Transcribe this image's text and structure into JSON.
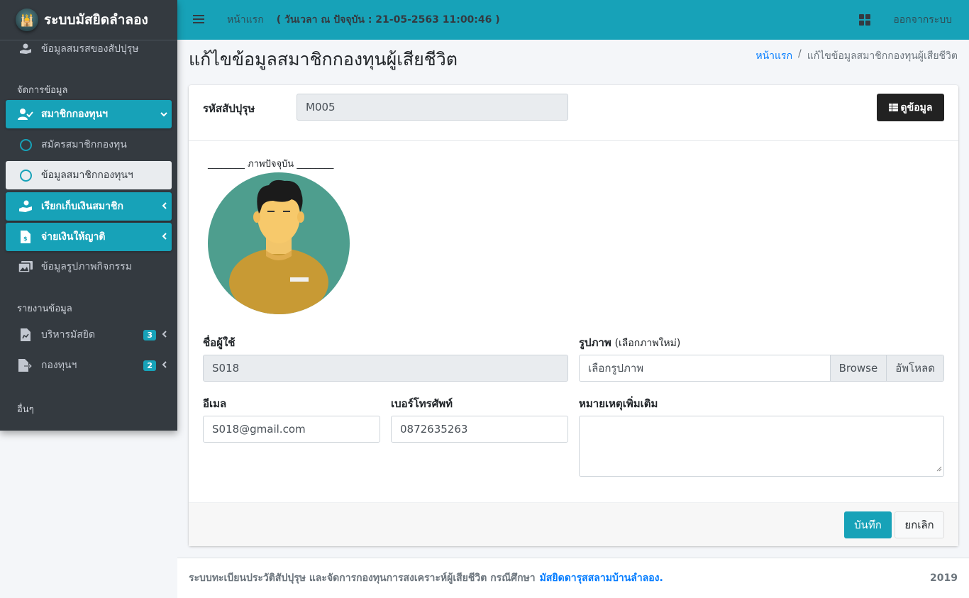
{
  "app": {
    "brand": "ระบบมัสยิดลำลอง"
  },
  "sidebar": {
    "top_item": "ข้อมูลสมรสของสัปปุรุษ",
    "header_manage": "จัดการข้อมูล",
    "members": "สมาชิกกองทุนฯ",
    "register": "สมัครสมาชิกกองทุน",
    "member_data": "ข้อมูลสมาชิกกองทุนฯ",
    "collect": "เรียกเก็บเงินสมาชิก",
    "pay": "จ่ายเงินให้ญาติ",
    "photos": "ข้อมูลรูปภาพกิจกรรม",
    "header_report": "รายงานข้อมูล",
    "mosque_admin": "บริหารมัสยิด",
    "mosque_admin_badge": "3",
    "fund": "กองทุนฯ",
    "fund_badge": "2",
    "header_other": "อื่นๆ"
  },
  "topbar": {
    "home": "หน้าแรก",
    "time": "( วันเวลา ณ ปัจจุบัน : 21-05-2563 11:00:46 )",
    "logout": "ออกจากระบบ"
  },
  "page": {
    "title": "แก้ไขข้อมูลสมาชิกกองทุนผู้เสียชีวิต",
    "breadcrumb_home": "หน้าแรก",
    "breadcrumb_sep": "/",
    "breadcrumb_current": "แก้ไขข้อมูลสมาชิกกองทุนผู้เสียชีวิต"
  },
  "form": {
    "code_label": "รหัสสัปปุรุษ",
    "code_value": "M005",
    "view_button": "ดูข้อมูล",
    "photo_caption": "________ ภาพปัจจุบัน ________",
    "username_label": "ชื่อผู้ใช้",
    "username_value": "S018",
    "image_label": "รูปภาพ",
    "image_hint": "(เลือกภาพใหม่)",
    "file_placeholder": "เลือกรูปภาพ",
    "browse": "Browse",
    "upload": "อัพโหลด",
    "email_label": "อีเมล",
    "email_value": "S018@gmail.com",
    "phone_label": "เบอร์โทรศัพท์",
    "phone_value": "0872635263",
    "note_label": "หมายเหตุเพิ่มเติม",
    "note_value": "",
    "save": "บันทึก",
    "cancel": "ยกเลิก"
  },
  "footer": {
    "text": "ระบบทะเบียนประวัติสัปปุรุษ และจัดการกองทุนการสงเคราะห์ผู้เสียชีวิต กรณีศึกษา",
    "link": "มัสยิดดารุสสลามบ้านลำลอง.",
    "year": "2019"
  },
  "colors": {
    "accent": "#17a2b8",
    "sidebar": "#343a40"
  }
}
